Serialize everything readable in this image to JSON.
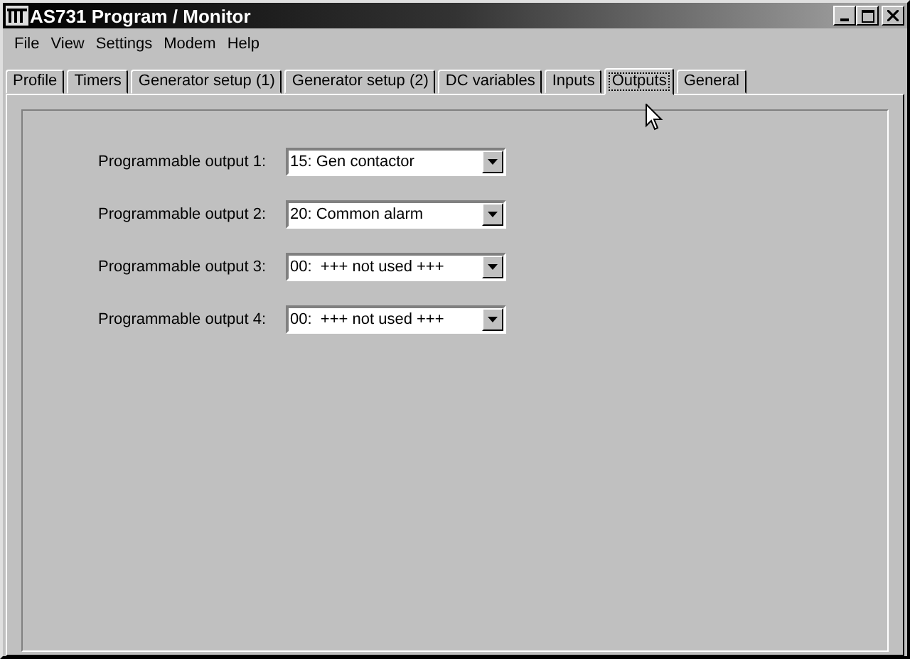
{
  "window": {
    "title": "AS731 Program / Monitor"
  },
  "menu": [
    "File",
    "View",
    "Settings",
    "Modem",
    "Help"
  ],
  "tabs": [
    {
      "label": "Profile",
      "selected": false
    },
    {
      "label": "Timers",
      "selected": false
    },
    {
      "label": "Generator setup (1)",
      "selected": false
    },
    {
      "label": "Generator setup (2)",
      "selected": false
    },
    {
      "label": "DC variables",
      "selected": false
    },
    {
      "label": "Inputs",
      "selected": false
    },
    {
      "label": "Outputs",
      "selected": true
    },
    {
      "label": "General",
      "selected": false
    }
  ],
  "outputs": [
    {
      "label": "Programmable output 1:",
      "value": "15: Gen contactor"
    },
    {
      "label": "Programmable output 2:",
      "value": "20: Common alarm"
    },
    {
      "label": "Programmable output 3:",
      "value": "00:  +++ not used +++"
    },
    {
      "label": "Programmable output 4:",
      "value": "00:  +++ not used +++"
    }
  ]
}
